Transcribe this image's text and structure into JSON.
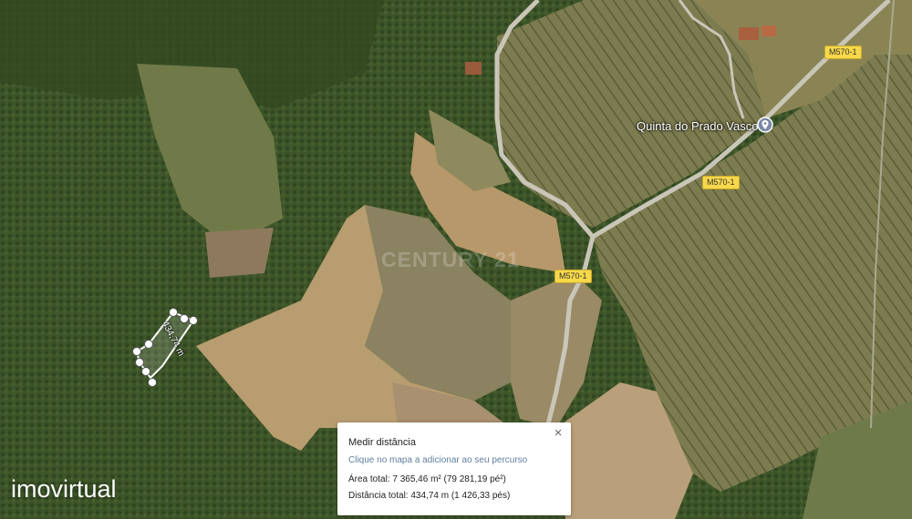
{
  "map": {
    "poi_name": "Quinta do Prado Vasco",
    "road_labels": [
      "M570-1",
      "M570-1",
      "M570-1"
    ],
    "watermark": "CENTURY 21",
    "measure_label": "434,74 m"
  },
  "brand": {
    "name": "imovirtual"
  },
  "panel": {
    "title": "Medir distância",
    "hint": "Clique no mapa a adicionar ao seu percurso",
    "area": "Área total: 7 365,46 m² (79 281,19 pé²)",
    "distance": "Distância total: 434,74 m (1 426,33 pés)",
    "close_icon": "×"
  },
  "colors": {
    "road_label_bg": "#f7d84a",
    "forest": "#3f5a2a",
    "field": "#b79d72"
  }
}
